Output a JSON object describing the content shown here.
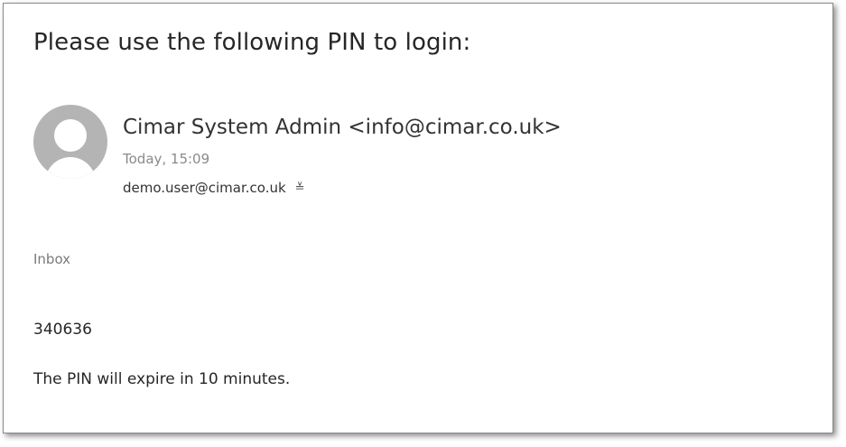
{
  "email": {
    "subject": "Please use the following PIN to login:",
    "sender": "Cimar System Admin <info@cimar.co.uk>",
    "timestamp": "Today, 15:09",
    "recipient": "demo.user@cimar.co.uk",
    "expand_icon": "double-chevron-down-icon",
    "expand_glyph": "≚",
    "folder": "Inbox",
    "body": {
      "pin": "340636",
      "note": "The PIN will expire in 10 minutes."
    }
  }
}
